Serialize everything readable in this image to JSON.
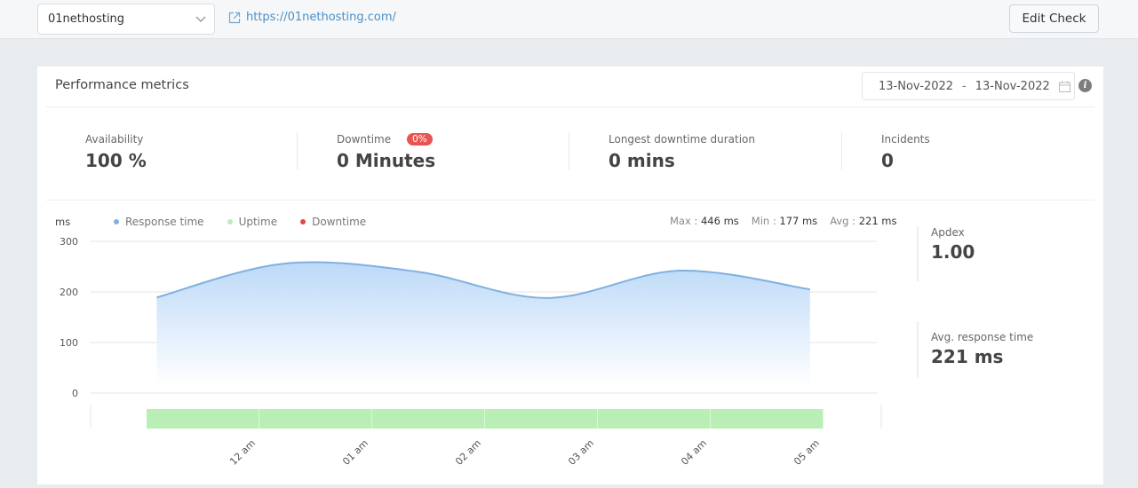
{
  "topbar": {
    "site_select": {
      "value": "01nethosting",
      "icon": "chevron-down-icon"
    },
    "site_link": {
      "text": "https://01nethosting.com/",
      "icon": "external-link-icon"
    },
    "edit_button": "Edit Check"
  },
  "card": {
    "title": "Performance metrics",
    "date_from": "13-Nov-2022",
    "date_separator": "-",
    "date_to": "13-Nov-2022",
    "info_icon": "i"
  },
  "stats": [
    {
      "label": "Availability",
      "value": "100 %"
    },
    {
      "label": "Downtime",
      "badge": "0%",
      "value": "0 Minutes"
    },
    {
      "label": "Longest downtime duration",
      "value": "0 mins"
    },
    {
      "label": "Incidents",
      "value": "0"
    }
  ],
  "side_stats": [
    {
      "label": "Apdex",
      "value": "1.00"
    },
    {
      "label": "Avg. response time",
      "value": "221 ms"
    }
  ],
  "legend": {
    "unit": "ms",
    "items": [
      {
        "label": "Response time",
        "color": "#7fb0e0"
      },
      {
        "label": "Uptime",
        "color": "#b9efb5"
      },
      {
        "label": "Downtime",
        "color": "#e04848"
      }
    ]
  },
  "summary": {
    "max_label": "Max :",
    "max_value": "446 ms",
    "min_label": "Min :",
    "min_value": "177 ms",
    "avg_label": "Avg :",
    "avg_value": "221 ms"
  },
  "chart_data": {
    "type": "area",
    "title": "",
    "xlabel": "",
    "ylabel": "ms",
    "ylim": [
      0,
      300
    ],
    "yticks": [
      0,
      100,
      200,
      300
    ],
    "grid": true,
    "legend_position": "top-left",
    "xticks": [
      "12 am",
      "01 am",
      "02 am",
      "03 am",
      "04 am",
      "05 am"
    ],
    "x_hours": [
      -0.91,
      0.22,
      1.4,
      2.55,
      3.72,
      4.88
    ],
    "series": [
      {
        "name": "Response time",
        "color": "#7fb0e0",
        "values": [
          189,
          256,
          240,
          188,
          242,
          205
        ]
      }
    ],
    "uptime_segments": [
      {
        "start_hour": -1.0,
        "end_hour": 0,
        "status": "up"
      },
      {
        "start_hour": 0,
        "end_hour": 1,
        "status": "up"
      },
      {
        "start_hour": 1,
        "end_hour": 2,
        "status": "up"
      },
      {
        "start_hour": 2,
        "end_hour": 3,
        "status": "up"
      },
      {
        "start_hour": 3,
        "end_hour": 4,
        "status": "up"
      },
      {
        "start_hour": 4,
        "end_hour": 5,
        "status": "up"
      }
    ],
    "uptime_color": "#b9efb5"
  }
}
